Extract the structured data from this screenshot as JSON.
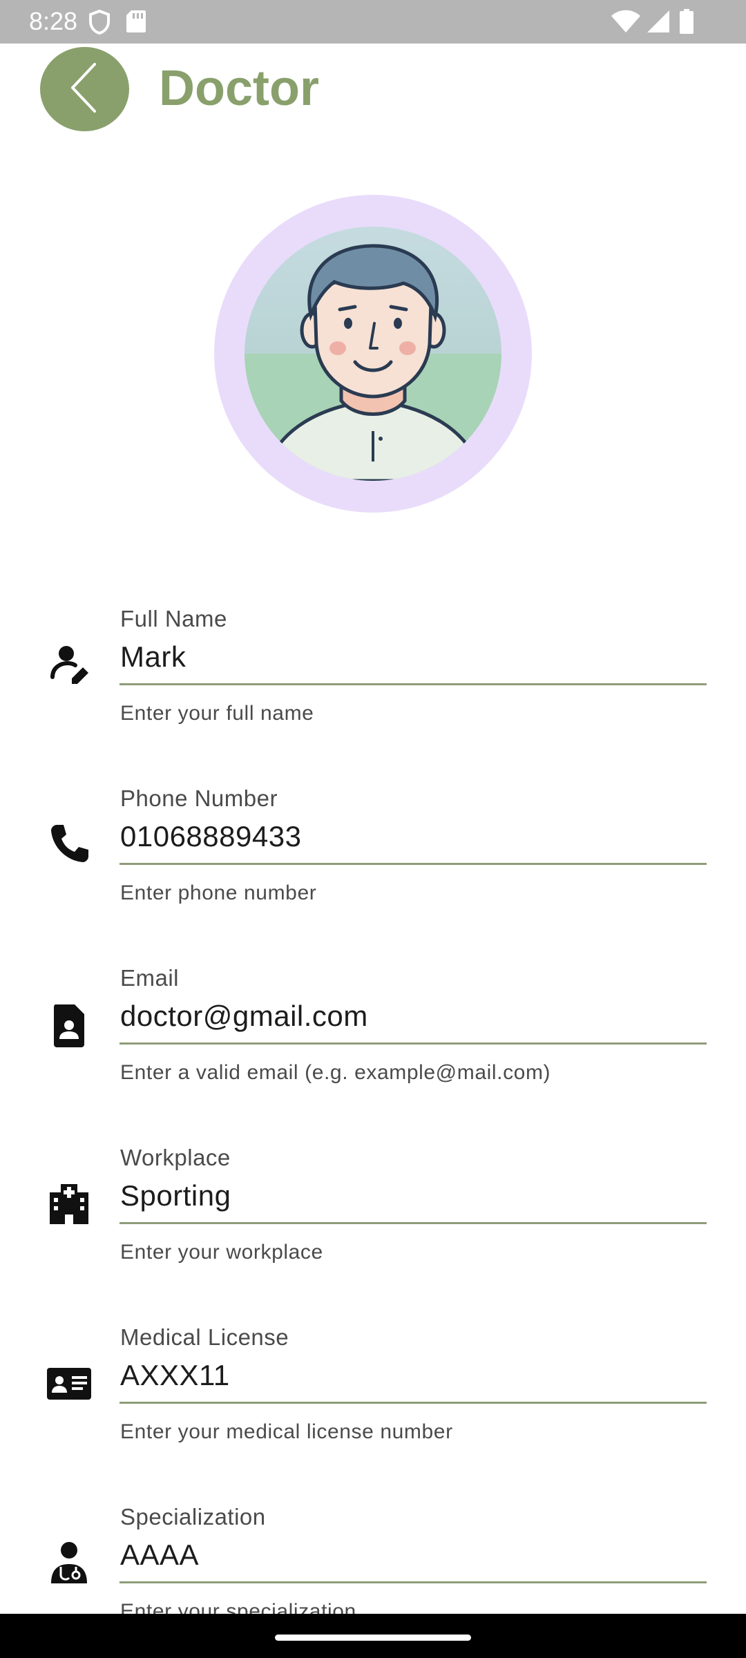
{
  "status_bar": {
    "time": "8:28",
    "icons_left": [
      "shield-icon",
      "sd-card-icon"
    ],
    "icons_right": [
      "wifi-icon",
      "cellular-signal-icon",
      "battery-icon"
    ]
  },
  "header": {
    "title": "Doctor",
    "back_icon": "chevron-left-icon",
    "accent_color": "#89a06c"
  },
  "avatar": {
    "ring_color": "#e9dcfb",
    "description_icon": "doctor-avatar"
  },
  "fields": [
    {
      "label": "Full Name",
      "value": "Mark",
      "helper": "Enter your full name",
      "icon": "person-edit-icon"
    },
    {
      "label": "Phone Number",
      "value": "01068889433",
      "helper": "Enter phone number",
      "icon": "phone-icon"
    },
    {
      "label": "Email",
      "value": "doctor@gmail.com",
      "helper": "Enter a valid email (e.g. example@mail.com)",
      "icon": "contact-document-icon"
    },
    {
      "label": "Workplace",
      "value": "Sporting",
      "helper": "Enter your workplace",
      "icon": "hospital-icon"
    },
    {
      "label": "Medical License",
      "value": "AXXX11",
      "helper": "Enter your medical license number",
      "icon": "id-card-icon"
    },
    {
      "label": "Specialization",
      "value": "AAAA",
      "helper": "Enter your specialization",
      "icon": "doctor-stethoscope-icon"
    }
  ]
}
